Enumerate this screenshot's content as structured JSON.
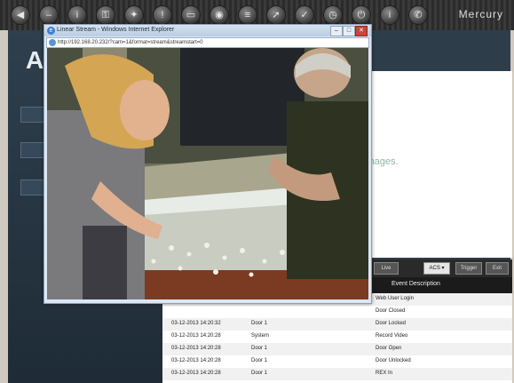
{
  "toolbar": {
    "icons": [
      "back-icon",
      "minus-icon",
      "info-icon",
      "lock-icon",
      "lightbulb-icon",
      "alert-icon",
      "folder-icon",
      "camera-icon",
      "list-icon",
      "arrow-icon",
      "check-icon",
      "clock-icon",
      "power-icon",
      "bell-icon",
      "refresh-icon",
      "info-circle-icon",
      "phone-icon"
    ],
    "brand": "Mercury"
  },
  "popup": {
    "title": "Linear Stream - Windows Internet Explorer",
    "url": "http://192.168.20.232/?cam=1&format=stream&streamstart=0"
  },
  "main": {
    "preview_text": "images.",
    "controls": {
      "live": "Live",
      "select": "ACS ▾",
      "trigger": "Trigger",
      "exit": "Exit"
    },
    "event_header": "Event Description",
    "events": [
      {
        "time": "",
        "door": "",
        "desc": "Web User Login"
      },
      {
        "time": "",
        "door": "",
        "desc": "Door Closed"
      },
      {
        "time": "03-12-2013 14:20:32",
        "door": "Door 1",
        "desc": "Door Locked"
      },
      {
        "time": "03-12-2013 14:20:28",
        "door": "System",
        "desc": "Record Video"
      },
      {
        "time": "03-12-2013 14:20:28",
        "door": "Door 1",
        "desc": "Door Open"
      },
      {
        "time": "03-12-2013 14:20:28",
        "door": "Door 1",
        "desc": "Door Unlocked"
      },
      {
        "time": "03-12-2013 14:20:28",
        "door": "Door 1",
        "desc": "REX In"
      }
    ]
  }
}
